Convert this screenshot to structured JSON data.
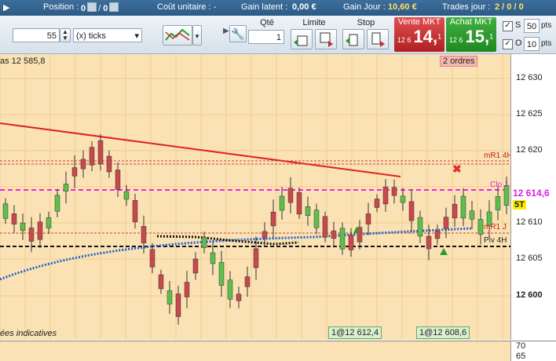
{
  "topbar": {
    "position_label": "Position :",
    "position_value": "0",
    "position_value2": "0",
    "unit_cost_label": "Coût unitaire :",
    "unit_cost_value": "-",
    "latent_label": "Gain latent :",
    "latent_value": "0,00 €",
    "day_gain_label": "Gain Jour :",
    "day_gain_value": "10,60 €",
    "trades_label": "Trades jour :",
    "trades_value": "2 / 0 / 0"
  },
  "toolbar": {
    "ticks_value": "55",
    "ticks_unit": "(x) ticks",
    "qty_label": "Qté",
    "qty_value": "1",
    "limit_label": "Limite",
    "stop_label": "Stop",
    "sell_label": "Vente MKT",
    "sell_prefix": "12 6",
    "sell_big": "14,",
    "sell_sup": "1",
    "buy_label": "Achat MKT",
    "buy_prefix": "12 6",
    "buy_big": "15,",
    "buy_sup": "1",
    "s_label": "S",
    "s_value": "50",
    "o_label": "O",
    "o_value": "10",
    "pts": "pts",
    "check_mark": "✓"
  },
  "chart": {
    "header_text": "as 12 585,8",
    "orders_badge": "2 ordres",
    "footer_text": "ées indicatives",
    "tag_r1_4h": "mR1 4H",
    "tag_clo_j": "Clo J",
    "tag_r1_j": "mR1 J",
    "tag_piv_4h": "Piv 4H",
    "label_5t": "5T",
    "order1": "1@12 612,4",
    "order2": "1@12 608,6",
    "current_price": "12 614,6",
    "ylim": [
      12597,
      12633
    ],
    "yticks": [
      "12 630",
      "12 625",
      "12 620",
      "12 615",
      "12 610",
      "12 605",
      "12 600"
    ],
    "lower_ticks": [
      "70",
      "65"
    ],
    "colors": {
      "up": "#5cc04a",
      "down": "#c8484c",
      "magenta": "#ee22ee",
      "red_line": "#e02020",
      "blue": "#2060d0"
    }
  }
}
